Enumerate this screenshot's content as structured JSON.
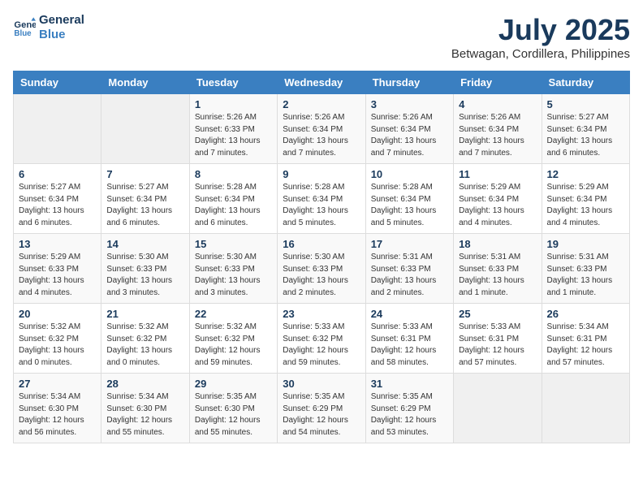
{
  "header": {
    "logo_line1": "General",
    "logo_line2": "Blue",
    "month_year": "July 2025",
    "location": "Betwagan, Cordillera, Philippines"
  },
  "weekdays": [
    "Sunday",
    "Monday",
    "Tuesday",
    "Wednesday",
    "Thursday",
    "Friday",
    "Saturday"
  ],
  "weeks": [
    [
      {
        "day": "",
        "sunrise": "",
        "sunset": "",
        "daylight": ""
      },
      {
        "day": "",
        "sunrise": "",
        "sunset": "",
        "daylight": ""
      },
      {
        "day": "1",
        "sunrise": "Sunrise: 5:26 AM",
        "sunset": "Sunset: 6:33 PM",
        "daylight": "Daylight: 13 hours and 7 minutes."
      },
      {
        "day": "2",
        "sunrise": "Sunrise: 5:26 AM",
        "sunset": "Sunset: 6:34 PM",
        "daylight": "Daylight: 13 hours and 7 minutes."
      },
      {
        "day": "3",
        "sunrise": "Sunrise: 5:26 AM",
        "sunset": "Sunset: 6:34 PM",
        "daylight": "Daylight: 13 hours and 7 minutes."
      },
      {
        "day": "4",
        "sunrise": "Sunrise: 5:26 AM",
        "sunset": "Sunset: 6:34 PM",
        "daylight": "Daylight: 13 hours and 7 minutes."
      },
      {
        "day": "5",
        "sunrise": "Sunrise: 5:27 AM",
        "sunset": "Sunset: 6:34 PM",
        "daylight": "Daylight: 13 hours and 6 minutes."
      }
    ],
    [
      {
        "day": "6",
        "sunrise": "Sunrise: 5:27 AM",
        "sunset": "Sunset: 6:34 PM",
        "daylight": "Daylight: 13 hours and 6 minutes."
      },
      {
        "day": "7",
        "sunrise": "Sunrise: 5:27 AM",
        "sunset": "Sunset: 6:34 PM",
        "daylight": "Daylight: 13 hours and 6 minutes."
      },
      {
        "day": "8",
        "sunrise": "Sunrise: 5:28 AM",
        "sunset": "Sunset: 6:34 PM",
        "daylight": "Daylight: 13 hours and 6 minutes."
      },
      {
        "day": "9",
        "sunrise": "Sunrise: 5:28 AM",
        "sunset": "Sunset: 6:34 PM",
        "daylight": "Daylight: 13 hours and 5 minutes."
      },
      {
        "day": "10",
        "sunrise": "Sunrise: 5:28 AM",
        "sunset": "Sunset: 6:34 PM",
        "daylight": "Daylight: 13 hours and 5 minutes."
      },
      {
        "day": "11",
        "sunrise": "Sunrise: 5:29 AM",
        "sunset": "Sunset: 6:34 PM",
        "daylight": "Daylight: 13 hours and 4 minutes."
      },
      {
        "day": "12",
        "sunrise": "Sunrise: 5:29 AM",
        "sunset": "Sunset: 6:34 PM",
        "daylight": "Daylight: 13 hours and 4 minutes."
      }
    ],
    [
      {
        "day": "13",
        "sunrise": "Sunrise: 5:29 AM",
        "sunset": "Sunset: 6:33 PM",
        "daylight": "Daylight: 13 hours and 4 minutes."
      },
      {
        "day": "14",
        "sunrise": "Sunrise: 5:30 AM",
        "sunset": "Sunset: 6:33 PM",
        "daylight": "Daylight: 13 hours and 3 minutes."
      },
      {
        "day": "15",
        "sunrise": "Sunrise: 5:30 AM",
        "sunset": "Sunset: 6:33 PM",
        "daylight": "Daylight: 13 hours and 3 minutes."
      },
      {
        "day": "16",
        "sunrise": "Sunrise: 5:30 AM",
        "sunset": "Sunset: 6:33 PM",
        "daylight": "Daylight: 13 hours and 2 minutes."
      },
      {
        "day": "17",
        "sunrise": "Sunrise: 5:31 AM",
        "sunset": "Sunset: 6:33 PM",
        "daylight": "Daylight: 13 hours and 2 minutes."
      },
      {
        "day": "18",
        "sunrise": "Sunrise: 5:31 AM",
        "sunset": "Sunset: 6:33 PM",
        "daylight": "Daylight: 13 hours and 1 minute."
      },
      {
        "day": "19",
        "sunrise": "Sunrise: 5:31 AM",
        "sunset": "Sunset: 6:33 PM",
        "daylight": "Daylight: 13 hours and 1 minute."
      }
    ],
    [
      {
        "day": "20",
        "sunrise": "Sunrise: 5:32 AM",
        "sunset": "Sunset: 6:32 PM",
        "daylight": "Daylight: 13 hours and 0 minutes."
      },
      {
        "day": "21",
        "sunrise": "Sunrise: 5:32 AM",
        "sunset": "Sunset: 6:32 PM",
        "daylight": "Daylight: 13 hours and 0 minutes."
      },
      {
        "day": "22",
        "sunrise": "Sunrise: 5:32 AM",
        "sunset": "Sunset: 6:32 PM",
        "daylight": "Daylight: 12 hours and 59 minutes."
      },
      {
        "day": "23",
        "sunrise": "Sunrise: 5:33 AM",
        "sunset": "Sunset: 6:32 PM",
        "daylight": "Daylight: 12 hours and 59 minutes."
      },
      {
        "day": "24",
        "sunrise": "Sunrise: 5:33 AM",
        "sunset": "Sunset: 6:31 PM",
        "daylight": "Daylight: 12 hours and 58 minutes."
      },
      {
        "day": "25",
        "sunrise": "Sunrise: 5:33 AM",
        "sunset": "Sunset: 6:31 PM",
        "daylight": "Daylight: 12 hours and 57 minutes."
      },
      {
        "day": "26",
        "sunrise": "Sunrise: 5:34 AM",
        "sunset": "Sunset: 6:31 PM",
        "daylight": "Daylight: 12 hours and 57 minutes."
      }
    ],
    [
      {
        "day": "27",
        "sunrise": "Sunrise: 5:34 AM",
        "sunset": "Sunset: 6:30 PM",
        "daylight": "Daylight: 12 hours and 56 minutes."
      },
      {
        "day": "28",
        "sunrise": "Sunrise: 5:34 AM",
        "sunset": "Sunset: 6:30 PM",
        "daylight": "Daylight: 12 hours and 55 minutes."
      },
      {
        "day": "29",
        "sunrise": "Sunrise: 5:35 AM",
        "sunset": "Sunset: 6:30 PM",
        "daylight": "Daylight: 12 hours and 55 minutes."
      },
      {
        "day": "30",
        "sunrise": "Sunrise: 5:35 AM",
        "sunset": "Sunset: 6:29 PM",
        "daylight": "Daylight: 12 hours and 54 minutes."
      },
      {
        "day": "31",
        "sunrise": "Sunrise: 5:35 AM",
        "sunset": "Sunset: 6:29 PM",
        "daylight": "Daylight: 12 hours and 53 minutes."
      },
      {
        "day": "",
        "sunrise": "",
        "sunset": "",
        "daylight": ""
      },
      {
        "day": "",
        "sunrise": "",
        "sunset": "",
        "daylight": ""
      }
    ]
  ]
}
